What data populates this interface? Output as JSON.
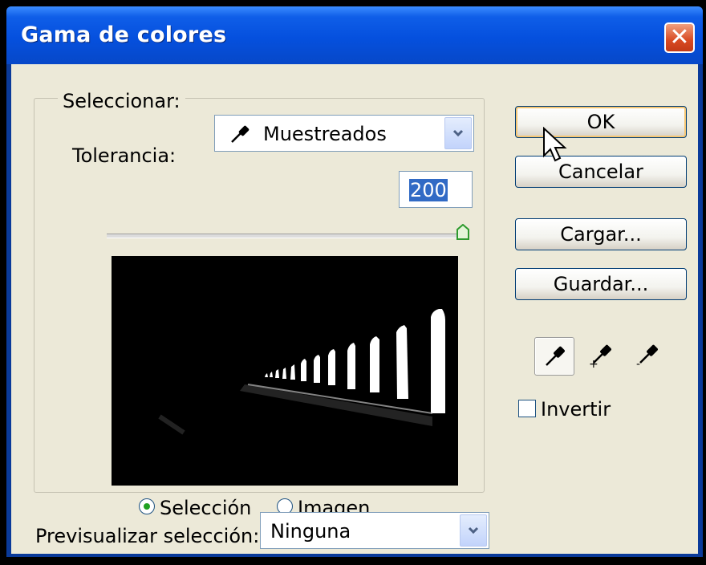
{
  "window": {
    "title": "Gama de colores",
    "close_label": "✕"
  },
  "selection": {
    "select_label": "Seleccionar:",
    "select_value": "Muestreados",
    "select_icon": "eyedropper-icon",
    "tolerance_label": "Tolerancia:",
    "tolerance_value": "200",
    "tolerance_slider_level": 1.0,
    "display_options": [
      {
        "label": "Selección",
        "checked": true
      },
      {
        "label": "Imagen",
        "checked": false
      }
    ]
  },
  "buttons": {
    "ok": "OK",
    "cancel": "Cancelar",
    "load": "Cargar...",
    "save": "Guardar..."
  },
  "tools": [
    {
      "icon": "eyedropper-icon",
      "active": true
    },
    {
      "icon": "eyedropper-plus-icon",
      "active": false
    },
    {
      "icon": "eyedropper-minus-icon",
      "active": false
    }
  ],
  "invert": {
    "label": "Invertir",
    "checked": false
  },
  "preview_selection": {
    "label": "Previsualizar selección:",
    "value": "Ninguna"
  },
  "colors": {
    "titlebar": "#0550de",
    "dialog_bg": "#ece9d8",
    "close_button": "#d84a22",
    "selection_highlight": "#316ac5",
    "default_button_ring": "#f5c673"
  }
}
